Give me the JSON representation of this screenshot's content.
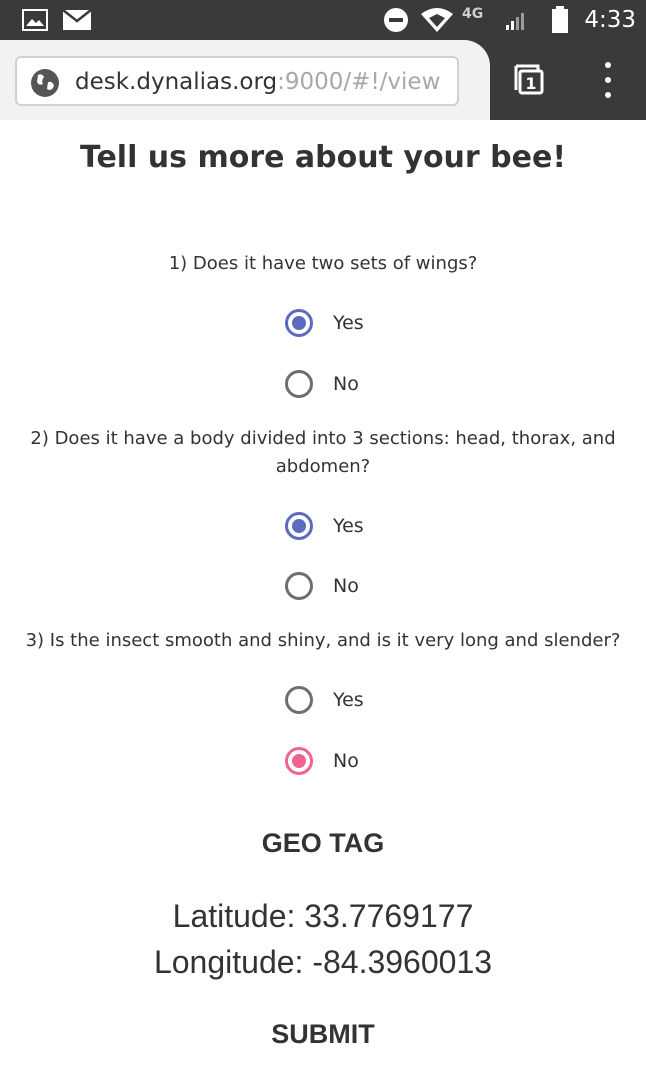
{
  "status_bar": {
    "time": "4:33",
    "network": "4G",
    "icons": [
      "image-notification-icon",
      "mail-icon",
      "do-not-disturb-icon",
      "wifi-icon",
      "signal-icon",
      "battery-icon"
    ]
  },
  "browser": {
    "url_host": "desk.dynalias.org",
    "url_rest": ":9000/#!/view",
    "tab_count": "1"
  },
  "page": {
    "title": "Tell us more about your bee!",
    "questions": [
      {
        "text": "1) Does it have two sets of wings?",
        "options": [
          {
            "label": "Yes",
            "selected": true
          },
          {
            "label": "No",
            "selected": false
          }
        ]
      },
      {
        "text": "2) Does it have a body divided into 3 sections: head, thorax, and abdomen?",
        "options": [
          {
            "label": "Yes",
            "selected": true
          },
          {
            "label": "No",
            "selected": false
          }
        ]
      },
      {
        "text": "3) Is the insect smooth and shiny, and is it very long and slender?",
        "options": [
          {
            "label": "Yes",
            "selected": false
          },
          {
            "label": "No",
            "selected": true
          }
        ]
      }
    ],
    "geo_tag": {
      "title": "GEO TAG",
      "latitude": "Latitude: 33.7769177",
      "longitude": "Longitude: -84.3960013"
    },
    "submit_label": "SUBMIT"
  },
  "colors": {
    "selected_primary": "#5c6bc0",
    "selected_accent": "#f06292",
    "status_bar": "#3a3a3a"
  }
}
